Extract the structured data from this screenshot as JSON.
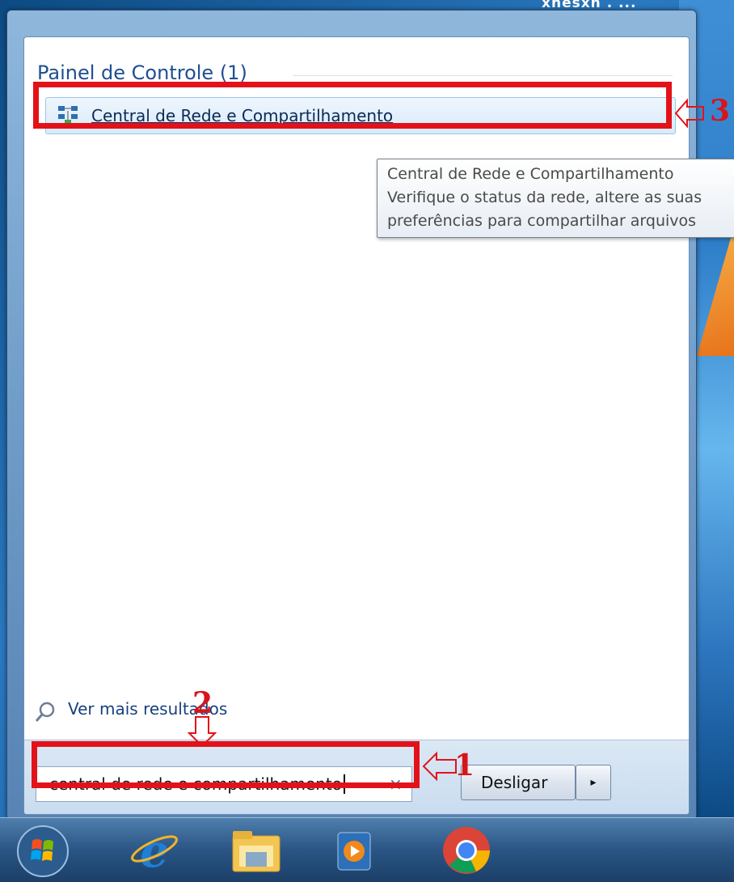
{
  "desktop": {
    "top_caption": "xnesxn . ..."
  },
  "start_menu": {
    "group_title": "Painel de Controle (1)",
    "result": {
      "label": "Central de Rede e Compartilhamento",
      "icon": "network-center-icon"
    },
    "tooltip": {
      "line1": "Central de Rede e Compartilhamento",
      "line2": "Verifique o status da rede, altere as suas",
      "line3": "preferências para compartilhar arquivos"
    },
    "more_results": {
      "label": "Ver mais resultados",
      "icon": "search-icon"
    },
    "search": {
      "value": "central de rede e compartilhamento",
      "clear_icon": "×"
    },
    "shutdown": {
      "label": "Desligar",
      "arrow": "▸"
    }
  },
  "annotations": {
    "marker_1": "1",
    "marker_2": "2",
    "marker_3": "3",
    "color": "#e31219"
  },
  "taskbar": {
    "items": [
      "start-orb-icon",
      "internet-explorer-icon",
      "file-explorer-icon",
      "media-player-icon",
      "chrome-icon"
    ]
  }
}
